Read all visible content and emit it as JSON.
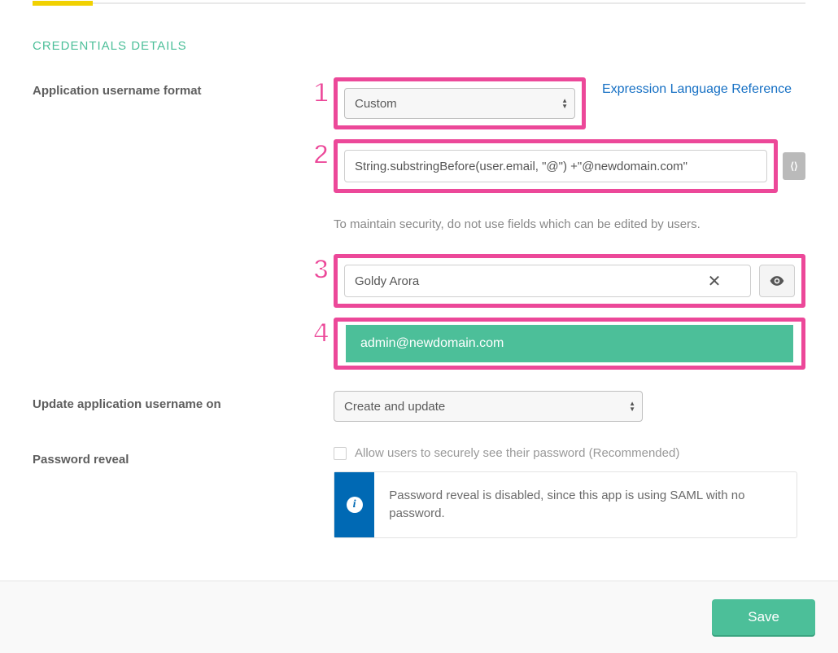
{
  "section_title": "CREDENTIALS DETAILS",
  "annotations": {
    "n1": "1",
    "n2": "2",
    "n3": "3",
    "n4": "4"
  },
  "username_format": {
    "label": "Application username format",
    "select_value": "Custom",
    "reference_link": "Expression Language Reference",
    "expression_value": "String.substringBefore(user.email, \"@\") +\"@newdomain.com\"",
    "hint": "To maintain security, do not use fields which can be edited by users.",
    "test_user_value": "Goldy Arora",
    "preview_result": "admin@newdomain.com"
  },
  "update_on": {
    "label": "Update application username on",
    "select_value": "Create and update"
  },
  "password_reveal": {
    "label": "Password reveal",
    "checkbox_label": "Allow users to securely see their password (Recommended)",
    "info_text": "Password reveal is disabled, since this app is using SAML with no password."
  },
  "footer": {
    "save_label": "Save"
  }
}
